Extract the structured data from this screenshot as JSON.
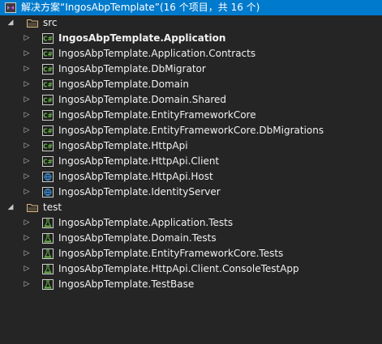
{
  "solution": {
    "label": "解决方案“IngosAbpTemplate”(16 个项目，共 16 个)",
    "icon": "visual-studio-solution-icon"
  },
  "folders": [
    {
      "id": "src",
      "label": "src",
      "icon": "folder-icon",
      "expanded": true,
      "projects": [
        {
          "label": "IngosAbpTemplate.Application",
          "icon": "csharp-project-icon",
          "bold": true
        },
        {
          "label": "IngosAbpTemplate.Application.Contracts",
          "icon": "csharp-project-icon"
        },
        {
          "label": "IngosAbpTemplate.DbMigrator",
          "icon": "csharp-project-icon"
        },
        {
          "label": "IngosAbpTemplate.Domain",
          "icon": "csharp-project-icon"
        },
        {
          "label": "IngosAbpTemplate.Domain.Shared",
          "icon": "csharp-project-icon"
        },
        {
          "label": "IngosAbpTemplate.EntityFrameworkCore",
          "icon": "csharp-project-icon"
        },
        {
          "label": "IngosAbpTemplate.EntityFrameworkCore.DbMigrations",
          "icon": "csharp-project-icon"
        },
        {
          "label": "IngosAbpTemplate.HttpApi",
          "icon": "csharp-project-icon"
        },
        {
          "label": "IngosAbpTemplate.HttpApi.Client",
          "icon": "csharp-project-icon"
        },
        {
          "label": "IngosAbpTemplate.HttpApi.Host",
          "icon": "web-project-icon"
        },
        {
          "label": "IngosAbpTemplate.IdentityServer",
          "icon": "web-project-icon"
        }
      ]
    },
    {
      "id": "test",
      "label": "test",
      "icon": "folder-icon",
      "expanded": true,
      "projects": [
        {
          "label": "IngosAbpTemplate.Application.Tests",
          "icon": "test-project-icon"
        },
        {
          "label": "IngosAbpTemplate.Domain.Tests",
          "icon": "test-project-icon"
        },
        {
          "label": "IngosAbpTemplate.EntityFrameworkCore.Tests",
          "icon": "test-project-icon"
        },
        {
          "label": "IngosAbpTemplate.HttpApi.Client.ConsoleTestApp",
          "icon": "test-project-icon"
        },
        {
          "label": "IngosAbpTemplate.TestBase",
          "icon": "test-project-icon"
        }
      ]
    }
  ],
  "colors": {
    "background": "#252526",
    "selection": "#007acc",
    "text": "#f1f1f1",
    "folder": "#dcb67a",
    "csharp": "#68b447",
    "web": "#3d8fd6",
    "test": "#68b447",
    "vs_purple": "#68217a"
  }
}
